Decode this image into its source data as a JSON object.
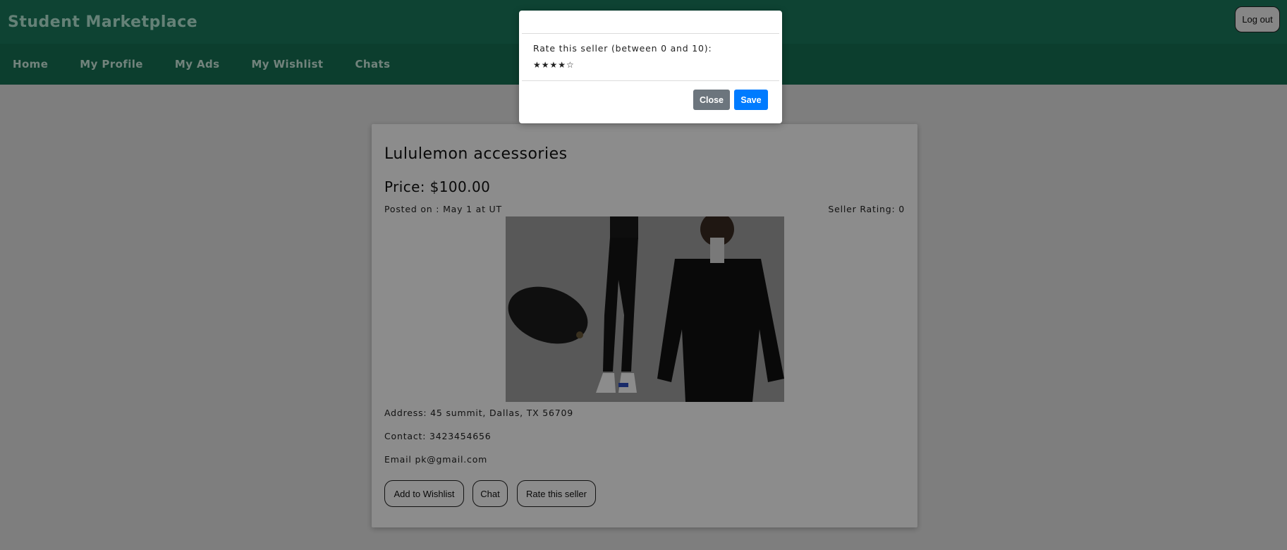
{
  "header": {
    "app_title": "Student Marketplace",
    "logout_label": "Log out"
  },
  "nav": {
    "items": [
      {
        "label": "Home"
      },
      {
        "label": "My Profile"
      },
      {
        "label": "My Ads"
      },
      {
        "label": "My Wishlist"
      },
      {
        "label": "Chats"
      }
    ]
  },
  "ad": {
    "title": "Lululemon accessories",
    "price": "Price: $100.00",
    "posted": "Posted on : May 1  at UT",
    "seller_rating": "Seller Rating: 0",
    "address": "Address:  45 summit, Dallas, TX 56709",
    "contact": "Contact:  3423454656",
    "email": "Email  pk@gmail.com",
    "buttons": {
      "wishlist": "Add to Wishlist",
      "chat": "Chat",
      "rate": "Rate this seller"
    }
  },
  "modal": {
    "prompt": "Rate this seller (between 0 and 10):",
    "stars": "★★★★☆",
    "close_label": "Close",
    "save_label": "Save"
  },
  "colors": {
    "header_bg": "#1b7a5e",
    "nav_bg": "#167154",
    "close_btn": "#6c757d",
    "save_btn": "#007bff"
  }
}
